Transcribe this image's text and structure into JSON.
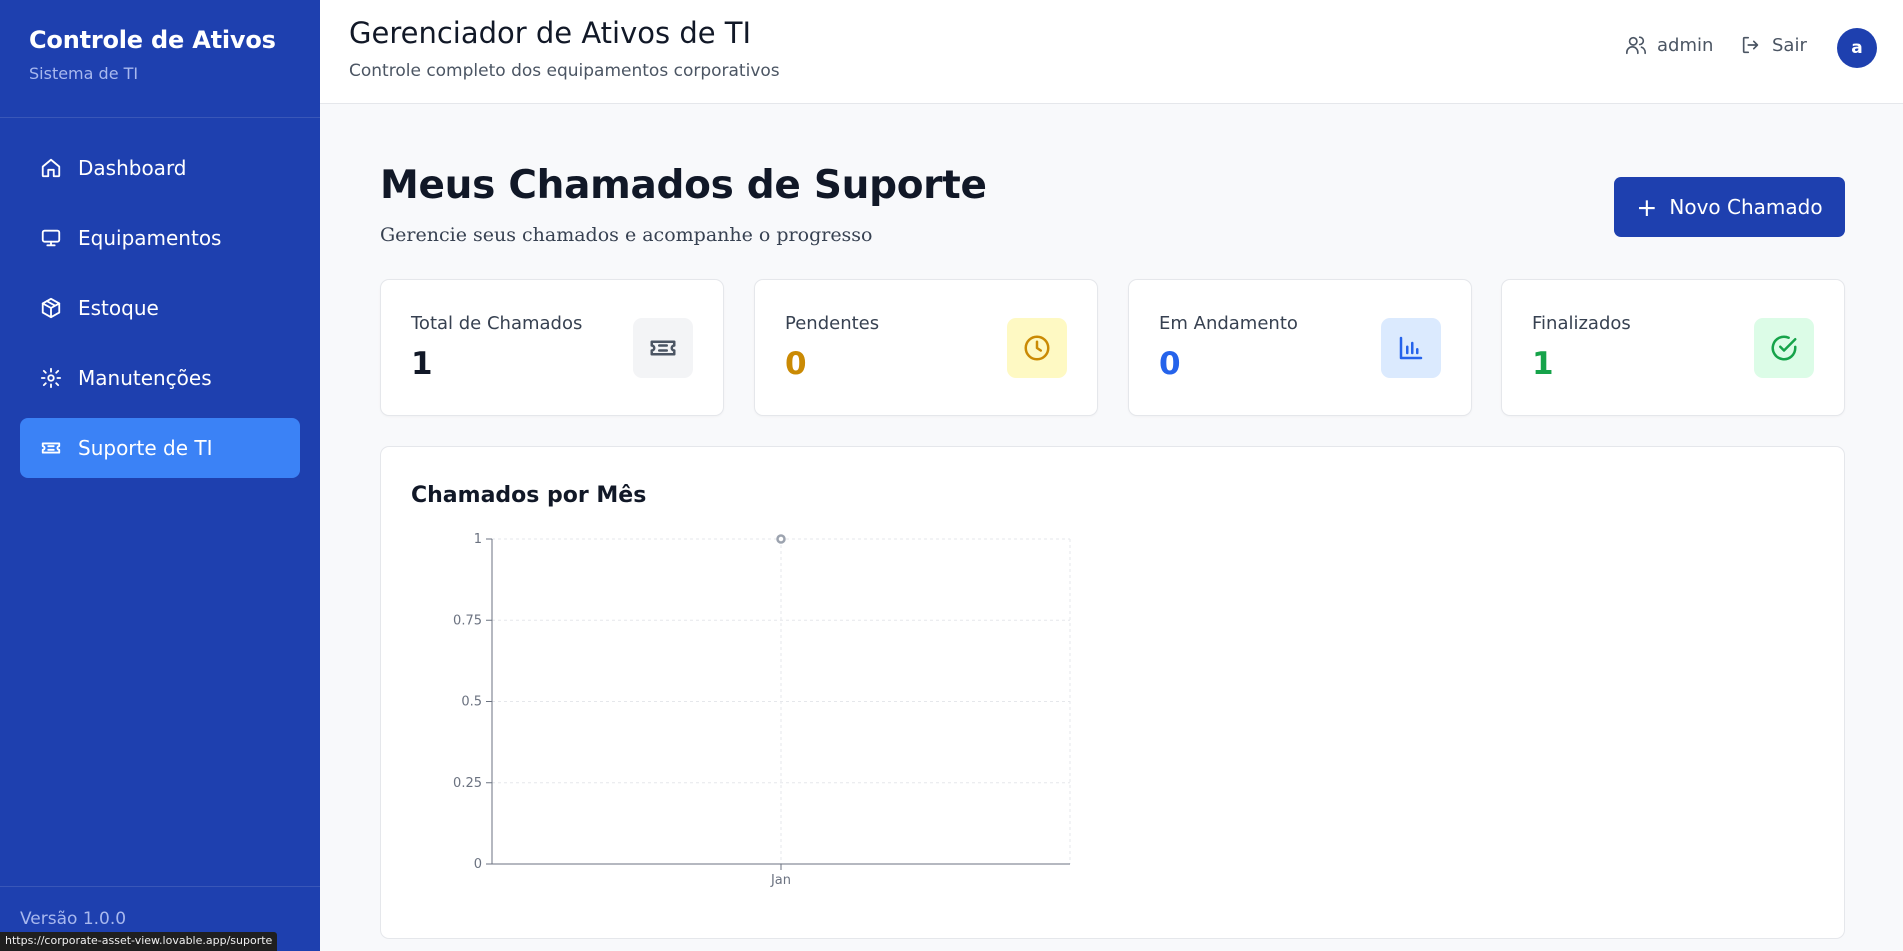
{
  "sidebar": {
    "brand_title": "Controle de Ativos",
    "brand_sub": "Sistema de TI",
    "items": [
      {
        "label": "Dashboard",
        "icon": "home-icon",
        "active": false
      },
      {
        "label": "Equipamentos",
        "icon": "monitor-icon",
        "active": false
      },
      {
        "label": "Estoque",
        "icon": "package-icon",
        "active": false
      },
      {
        "label": "Manutenções",
        "icon": "gear-icon",
        "active": false
      },
      {
        "label": "Suporte de TI",
        "icon": "ticket-icon",
        "active": true
      }
    ],
    "version": "Versão 1.0.0"
  },
  "status_url": "https://corporate-asset-view.lovable.app/suporte",
  "header": {
    "title": "Gerenciador de Ativos de TI",
    "subtitle": "Controle completo dos equipamentos corporativos",
    "user_label": "admin",
    "logout_label": "Sair",
    "avatar_initial": "a"
  },
  "main": {
    "title": "Meus Chamados de Suporte",
    "subtitle": "Gerencie seus chamados e acompanhe o progresso",
    "new_button_label": "Novo Chamado",
    "stats": [
      {
        "label": "Total de Chamados",
        "value": "1",
        "color": "#111827",
        "icon": "ticket-icon",
        "icon_bg": "#f3f4f6",
        "icon_color": "#4b5563"
      },
      {
        "label": "Pendentes",
        "value": "0",
        "color": "#ca8a04",
        "icon": "clock-icon",
        "icon_bg": "#fef9c3",
        "icon_color": "#ca8a04"
      },
      {
        "label": "Em Andamento",
        "value": "0",
        "color": "#2563eb",
        "icon": "bar-chart-icon",
        "icon_bg": "#dbeafe",
        "icon_color": "#2563eb"
      },
      {
        "label": "Finalizados",
        "value": "1",
        "color": "#16a34a",
        "icon": "check-circle-icon",
        "icon_bg": "#dcfce7",
        "icon_color": "#16a34a"
      }
    ],
    "chart_title": "Chamados por Mês"
  },
  "chart_data": {
    "type": "line",
    "title": "Chamados por Mês",
    "categories": [
      "Jan"
    ],
    "series": [
      {
        "values": [
          1
        ]
      }
    ],
    "ylim": [
      0,
      1
    ],
    "yticks": [
      "0",
      "0.25",
      "0.5",
      "0.75",
      "1"
    ],
    "grid": true
  }
}
